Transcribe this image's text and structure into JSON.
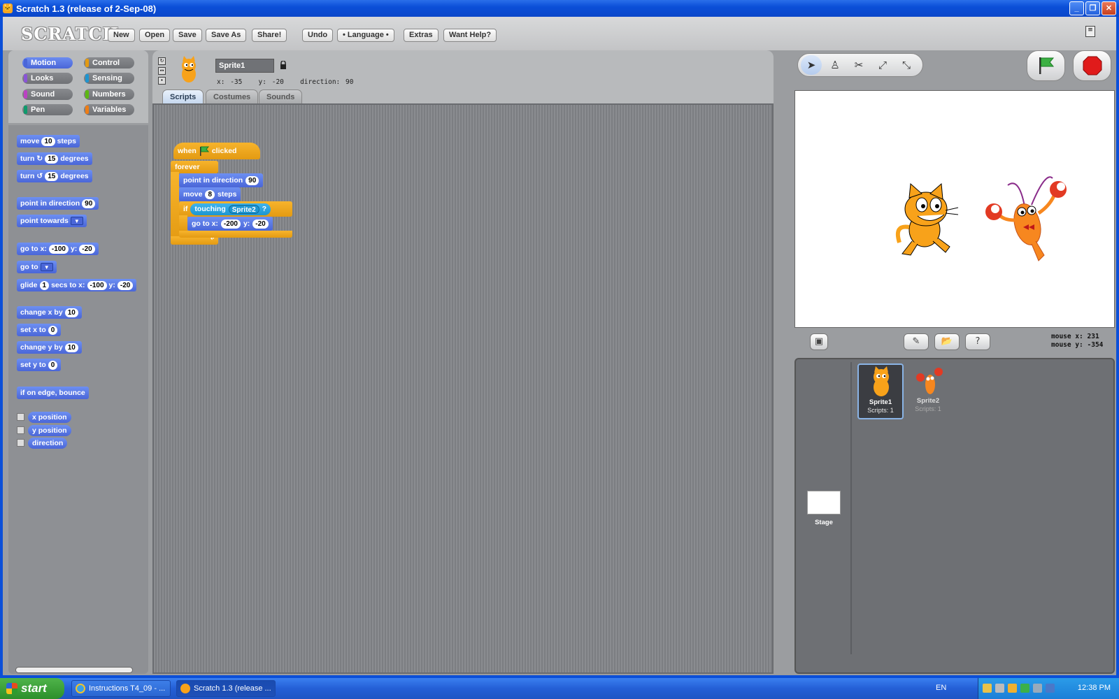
{
  "window": {
    "title": "Scratch 1.3 (release of 2-Sep-08)"
  },
  "menubar": {
    "logo": "SCRATCH",
    "buttons": [
      "New",
      "Open",
      "Save",
      "Save As",
      "Share!",
      "Undo",
      "• Language •",
      "Extras",
      "Want Help?"
    ]
  },
  "categories": [
    {
      "label": "Motion",
      "color": "#4a66d8"
    },
    {
      "label": "Control",
      "color": "#e39a12"
    },
    {
      "label": "Looks",
      "color": "#8a55d7"
    },
    {
      "label": "Sensing",
      "color": "#1e95d0"
    },
    {
      "label": "Sound",
      "color": "#bb42c3"
    },
    {
      "label": "Numbers",
      "color": "#5cb712"
    },
    {
      "label": "Pen",
      "color": "#0e9a6c"
    },
    {
      "label": "Variables",
      "color": "#ee7d16"
    }
  ],
  "palette": {
    "move": {
      "a": "move",
      "v": "10",
      "b": "steps"
    },
    "turn_cw": {
      "a": "turn",
      "v": "15",
      "b": "degrees"
    },
    "turn_ccw": {
      "a": "turn",
      "v": "15",
      "b": "degrees"
    },
    "point_dir": {
      "a": "point in direction",
      "v": "90"
    },
    "point_towards": {
      "a": "point towards"
    },
    "goto_xy": {
      "a": "go to x:",
      "x": "-100",
      "b": "y:",
      "y": "-20"
    },
    "goto": {
      "a": "go to"
    },
    "glide": {
      "a": "glide",
      "v": "1",
      "b": "secs to x:",
      "x": "-100",
      "c": "y:",
      "y": "-20"
    },
    "change_x": {
      "a": "change x by",
      "v": "10"
    },
    "set_x": {
      "a": "set x to",
      "v": "0"
    },
    "change_y": {
      "a": "change y by",
      "v": "10"
    },
    "set_y": {
      "a": "set y to",
      "v": "0"
    },
    "bounce": {
      "a": "if on edge, bounce"
    },
    "reporters": [
      "x position",
      "y position",
      "direction"
    ]
  },
  "sprite": {
    "name": "Sprite1",
    "x_label": "x:",
    "x": "-35",
    "y_label": "y:",
    "y": "-20",
    "dir_label": "direction:",
    "dir": "90"
  },
  "tabs": [
    "Scripts",
    "Costumes",
    "Sounds"
  ],
  "script": {
    "hat_a": "when",
    "hat_b": "clicked",
    "forever": "forever",
    "point": "point in direction",
    "point_v": "90",
    "move": "move",
    "move_v": "8",
    "move_b": "steps",
    "if": "if",
    "touching": "touching",
    "touching_v": "Sprite2",
    "q": "?",
    "goto_a": "go to x:",
    "goto_x": "-200",
    "goto_b": "y:",
    "goto_y": "-20"
  },
  "stage_info": {
    "mouse_x_label": "mouse x:",
    "mouse_x": "231",
    "mouse_y_label": "mouse y:",
    "mouse_y": "-354"
  },
  "sprites": [
    {
      "name": "Sprite1",
      "scripts": "Scripts: 1"
    },
    {
      "name": "Sprite2",
      "scripts": "Scripts: 1"
    }
  ],
  "stage_label": "Stage",
  "taskbar": {
    "start": "start",
    "tasks": [
      "Instructions T4_09 - ...",
      "Scratch 1.3 (release ..."
    ],
    "lang": "EN",
    "clock": "12:38 PM"
  }
}
